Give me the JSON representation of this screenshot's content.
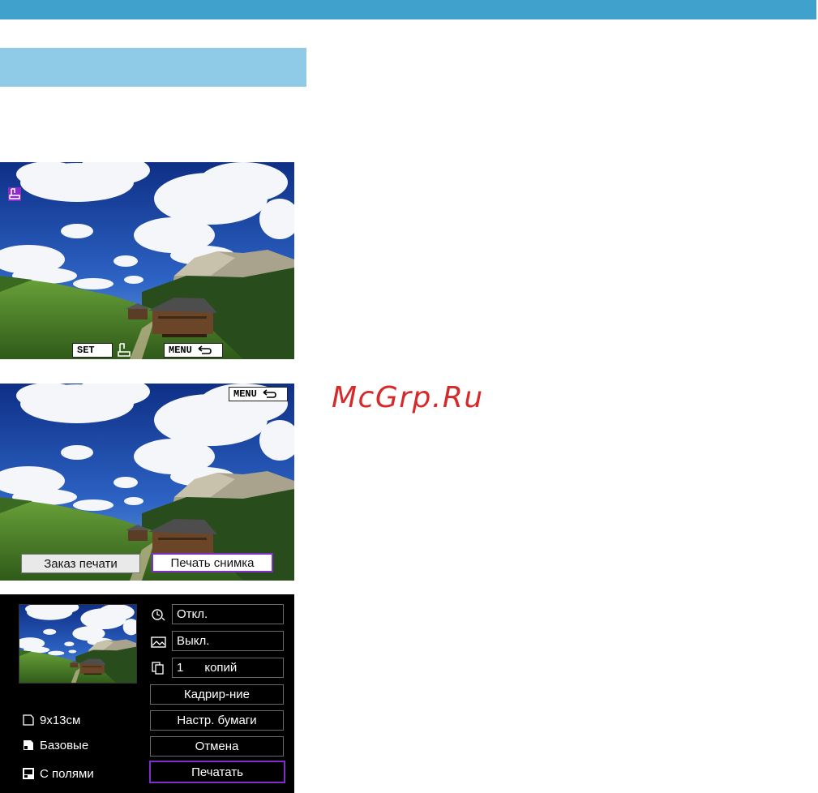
{
  "screen1": {
    "set_label": "SET",
    "menu_label": "MENU"
  },
  "screen2": {
    "menu_label": "MENU",
    "order_button": "Заказ печати",
    "print_photo_button": "Печать снимка"
  },
  "screen3": {
    "date_value": "Откл.",
    "effect_value": "Выкл.",
    "copies_count": "1",
    "copies_label": "копий",
    "crop_button": "Кадрир-ние",
    "paper_button": "Настр. бумаги",
    "cancel_button": "Отмена",
    "print_button": "Печатать",
    "paper_size": "9x13см",
    "paper_type": "Базовые",
    "layout": "С полями"
  },
  "watermark": "McGrp.Ru",
  "colors": {
    "top_bar": "#3fa1cc",
    "header_block": "#8fcbe6",
    "accent_purple": "#7d2fc7",
    "watermark_red": "#d62a2a"
  }
}
